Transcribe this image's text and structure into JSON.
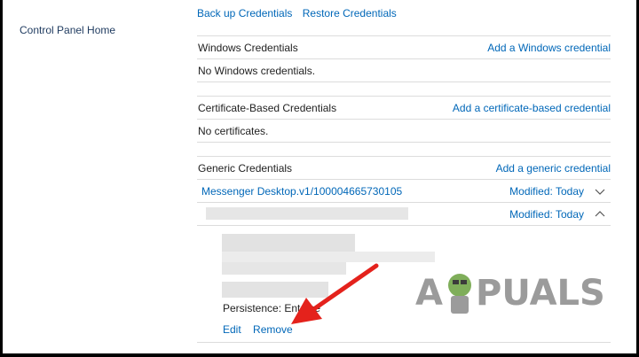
{
  "nav": {
    "control_panel_home": "Control Panel Home"
  },
  "top_links": {
    "backup": "Back up Credentials",
    "restore": "Restore Credentials"
  },
  "sections": {
    "windows": {
      "title": "Windows Credentials",
      "add_link": "Add a Windows credential",
      "empty_text": "No Windows credentials."
    },
    "certificate": {
      "title": "Certificate-Based Credentials",
      "add_link": "Add a certificate-based credential",
      "empty_text": "No certificates."
    },
    "generic": {
      "title": "Generic Credentials",
      "add_link": "Add a generic credential",
      "items": [
        {
          "name": "Messenger Desktop.v1/100004665730105",
          "modified": "Modified: Today",
          "expanded": false,
          "chevron": "chevron-down-icon"
        },
        {
          "name": "",
          "modified": "Modified: Today",
          "expanded": true,
          "chevron": "chevron-up-icon"
        }
      ]
    }
  },
  "details": {
    "persistence_label": "Persistence:",
    "persistence_value": "Ent...se",
    "edit": "Edit",
    "remove": "Remove"
  },
  "watermark": {
    "text_left": "A",
    "text_right": "PUALS"
  },
  "colors": {
    "link": "#0067b8",
    "arrow": "#e4221c",
    "divider": "#dcdcdc"
  }
}
